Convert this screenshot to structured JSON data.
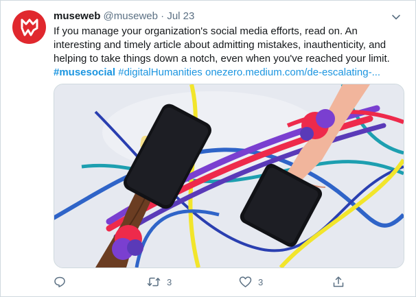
{
  "tweet": {
    "display_name": "museweb",
    "handle": "@museweb",
    "separator": "·",
    "date": "Jul 23",
    "text_lines": [
      "If you manage your organization's social media efforts, read on. An",
      "interesting and timely article about admitting mistakes, inauthenticity, and",
      "helping to take things down a notch, even when you've reached your limit."
    ],
    "hashtag_1": "#musesocial",
    "hashtag_2": "#digitalHumanities",
    "link": "onezero.medium.com/de-escalating-..."
  },
  "actions": {
    "reply_count": "",
    "retweet_count": "3",
    "like_count": "3"
  },
  "icons": {
    "avatar": "museweb-logo",
    "caret": "chevron-down-icon",
    "reply": "reply-icon",
    "retweet": "retweet-icon",
    "like": "heart-icon",
    "share": "share-icon"
  },
  "colors": {
    "link": "#1b95e0",
    "avatar_bg": "#e0282e",
    "muted": "#5b7083"
  }
}
